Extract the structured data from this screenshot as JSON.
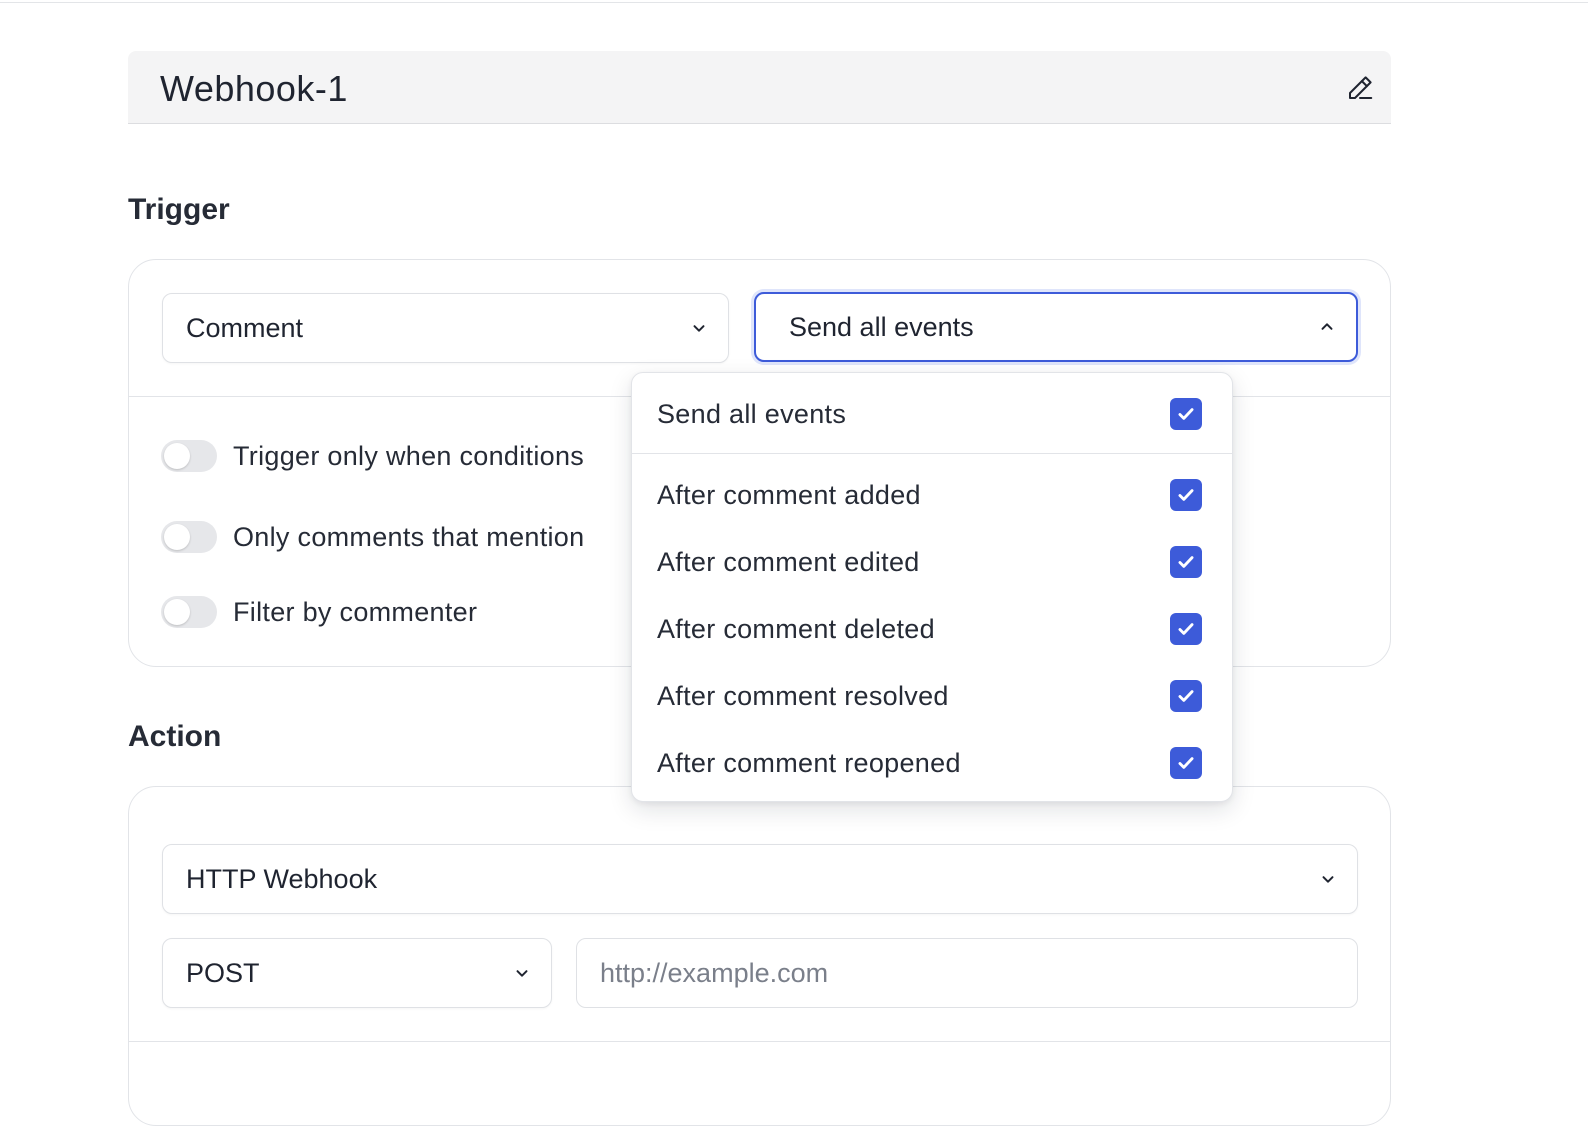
{
  "header": {
    "title": "Webhook-1",
    "edit_icon": "pencil-icon"
  },
  "trigger": {
    "heading": "Trigger",
    "resource_select": {
      "value": "Comment",
      "icon": "chevron-down-icon"
    },
    "events_select": {
      "value": "Send all events",
      "icon": "chevron-up-icon",
      "expanded": true
    },
    "toggles": [
      {
        "label": "Trigger only when conditions",
        "on": false
      },
      {
        "label": "Only comments that mention",
        "on": false
      },
      {
        "label": "Filter by commenter",
        "on": false
      }
    ]
  },
  "events_menu": {
    "items": [
      {
        "label": "Send all events",
        "checked": true
      },
      {
        "label": "After comment added",
        "checked": true
      },
      {
        "label": "After comment edited",
        "checked": true
      },
      {
        "label": "After comment deleted",
        "checked": true
      },
      {
        "label": "After comment resolved",
        "checked": true
      },
      {
        "label": "After comment reopened",
        "checked": true
      }
    ],
    "check_icon": "checkmark-icon"
  },
  "action": {
    "heading": "Action",
    "type_select": {
      "value": "HTTP Webhook",
      "icon": "chevron-down-icon"
    },
    "method_select": {
      "value": "POST",
      "icon": "chevron-down-icon"
    },
    "url_input": {
      "value": "",
      "placeholder": "http://example.com"
    }
  },
  "colors": {
    "accent": "#3d5bd9",
    "border": "#e2e4e8",
    "title_bar_bg": "#f4f4f5",
    "toggle_off": "#e6e7ea",
    "text": "#262b36",
    "placeholder": "#7a7f8a"
  }
}
